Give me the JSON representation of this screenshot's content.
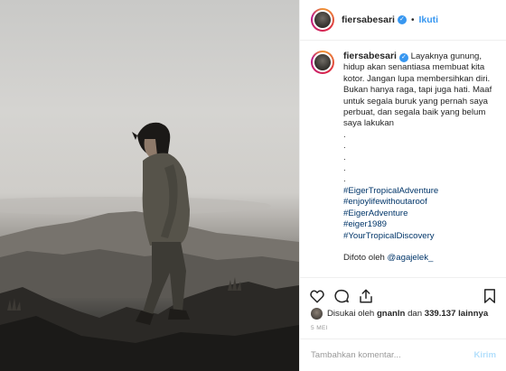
{
  "post": {
    "username": "fiersabesari",
    "verified": true,
    "follow_label": "Ikuti",
    "separator": "•"
  },
  "caption": {
    "username": "fiersabesari",
    "text": "Layaknya gunung, hidup akan senantiasa membuat kita kotor. Jangan lupa membersihkan diri. Bukan hanya raga, tapi juga hati. Maaf untuk segala buruk yang pernah saya perbuat, dan segala baik yang belum saya lakukan",
    "dots": [
      ".",
      ".",
      ".",
      ".",
      "."
    ],
    "hashtags": [
      "#EigerTropicalAdventure",
      "#enjoylifewithoutaroof",
      "#EigerAdventure",
      "#eiger1989",
      "#YourTropicalDiscovery"
    ],
    "credit_prefix": "Difoto oleh",
    "credit_mention": "@agajelek_"
  },
  "actions": {
    "like_icon": "heart-icon",
    "comment_icon": "comment-icon",
    "share_icon": "share-icon",
    "save_icon": "bookmark-icon"
  },
  "likes": {
    "prefix": "Disukai oleh",
    "user": "gnanln",
    "middle": "dan",
    "count": "339.137",
    "suffix": "lainnya"
  },
  "date": "5 MEI",
  "comment_input": {
    "placeholder": "Tambahkan komentar...",
    "post_label": "Kirim"
  },
  "colors": {
    "accent": "#3897f0",
    "link": "#003569",
    "muted": "#999999",
    "post_disabled": "#b2dffc"
  }
}
